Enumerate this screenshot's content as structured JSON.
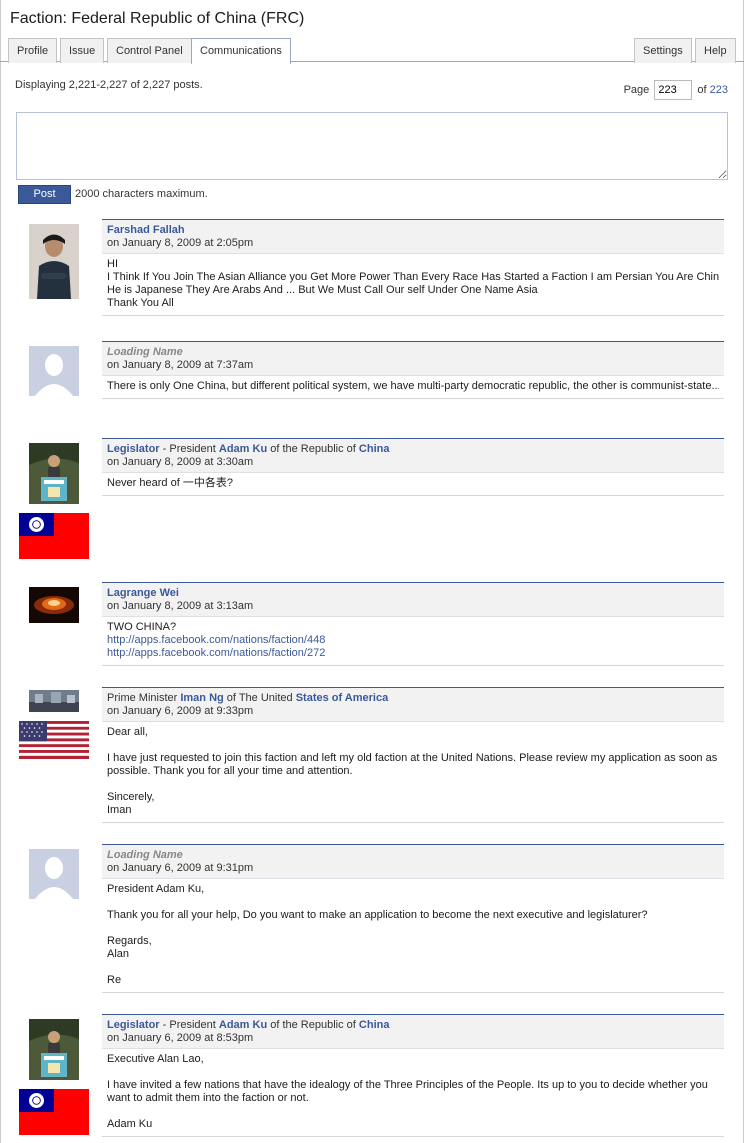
{
  "header": {
    "title": "Faction: Federal Republic of China (FRC)"
  },
  "tabs": {
    "profile": "Profile",
    "issue": "Issue",
    "control_panel": "Control Panel",
    "communications": "Communications",
    "settings": "Settings",
    "help": "Help"
  },
  "listing": {
    "displaying": "Displaying 2,221-2,227 of 2,227 posts."
  },
  "pager": {
    "page_label": "Page",
    "page_value": "223",
    "of_label": "of",
    "total_pages": "223"
  },
  "composer": {
    "post_label": "Post",
    "max_note": "2000 characters maximum."
  },
  "colors": {
    "accent": "#3b5998",
    "header_bg": "#f2f2f2",
    "flag_red": "#fe0000",
    "flag_blue": "#000095"
  },
  "posts": [
    {
      "name": "Farshad Fallah",
      "date": "on January 8, 2009 at 2:05pm",
      "lines": [
        "HI",
        "I Think If You Join The Asian Alliance you Get More Power Than Every Race Has Started a Faction I am Persian You Are Chines",
        "He is Japanese They Are Arabs And ... But We Must Call Our self Under One Name Asia",
        "Thank You All"
      ]
    },
    {
      "name": "Loading Name",
      "date": "on January 8, 2009 at 7:37am",
      "lines": [
        "There is only One China, but different political system, we have multi-party democratic republic, the other is communist-state..."
      ]
    },
    {
      "role": "Legislator",
      "sep": " - President ",
      "name": "Adam Ku",
      "of": " of the Republic of ",
      "nation": "China",
      "date": "on January 8, 2009 at 3:30am",
      "lines": [
        "Never heard of 一中各表?"
      ]
    },
    {
      "name": "Lagrange Wei",
      "date": "on January 8, 2009 at 3:13am",
      "lines": [
        "TWO CHINA?",
        "http://apps.facebook.com/nations/faction/448",
        "http://apps.facebook.com/nations/faction/272"
      ]
    },
    {
      "prefix": "Prime Minister ",
      "name": "Iman Ng",
      "of": " of The United ",
      "nation": "States of America",
      "date": "on January 6, 2009 at 9:33pm",
      "lines": [
        "Dear all,",
        "",
        "I have just requested to join this faction and left my old faction at the United Nations. Please review my application as soon as",
        "possible. Thank you for all your time and attention.",
        "",
        "Sincerely,",
        "Iman"
      ]
    },
    {
      "name": "Loading Name",
      "date": "on January 6, 2009 at 9:31pm",
      "lines": [
        "President Adam Ku,",
        "",
        "Thank you for all your help, Do you want to make an application to become the next executive and legislaturer?",
        "",
        "Regards,",
        "Alan",
        "",
        "Re"
      ]
    },
    {
      "role": "Legislator",
      "sep": " - President ",
      "name": "Adam Ku",
      "of": " of the Republic of ",
      "nation": "China",
      "date": "on January 6, 2009 at 8:53pm",
      "lines": [
        "Executive Alan Lao,",
        "",
        "I have invited a few nations that have the idealogy of the Three Principles of the People. Its up to you to decide whether you",
        "want to admit them into the faction or not.",
        "",
        "Adam Ku"
      ]
    }
  ]
}
